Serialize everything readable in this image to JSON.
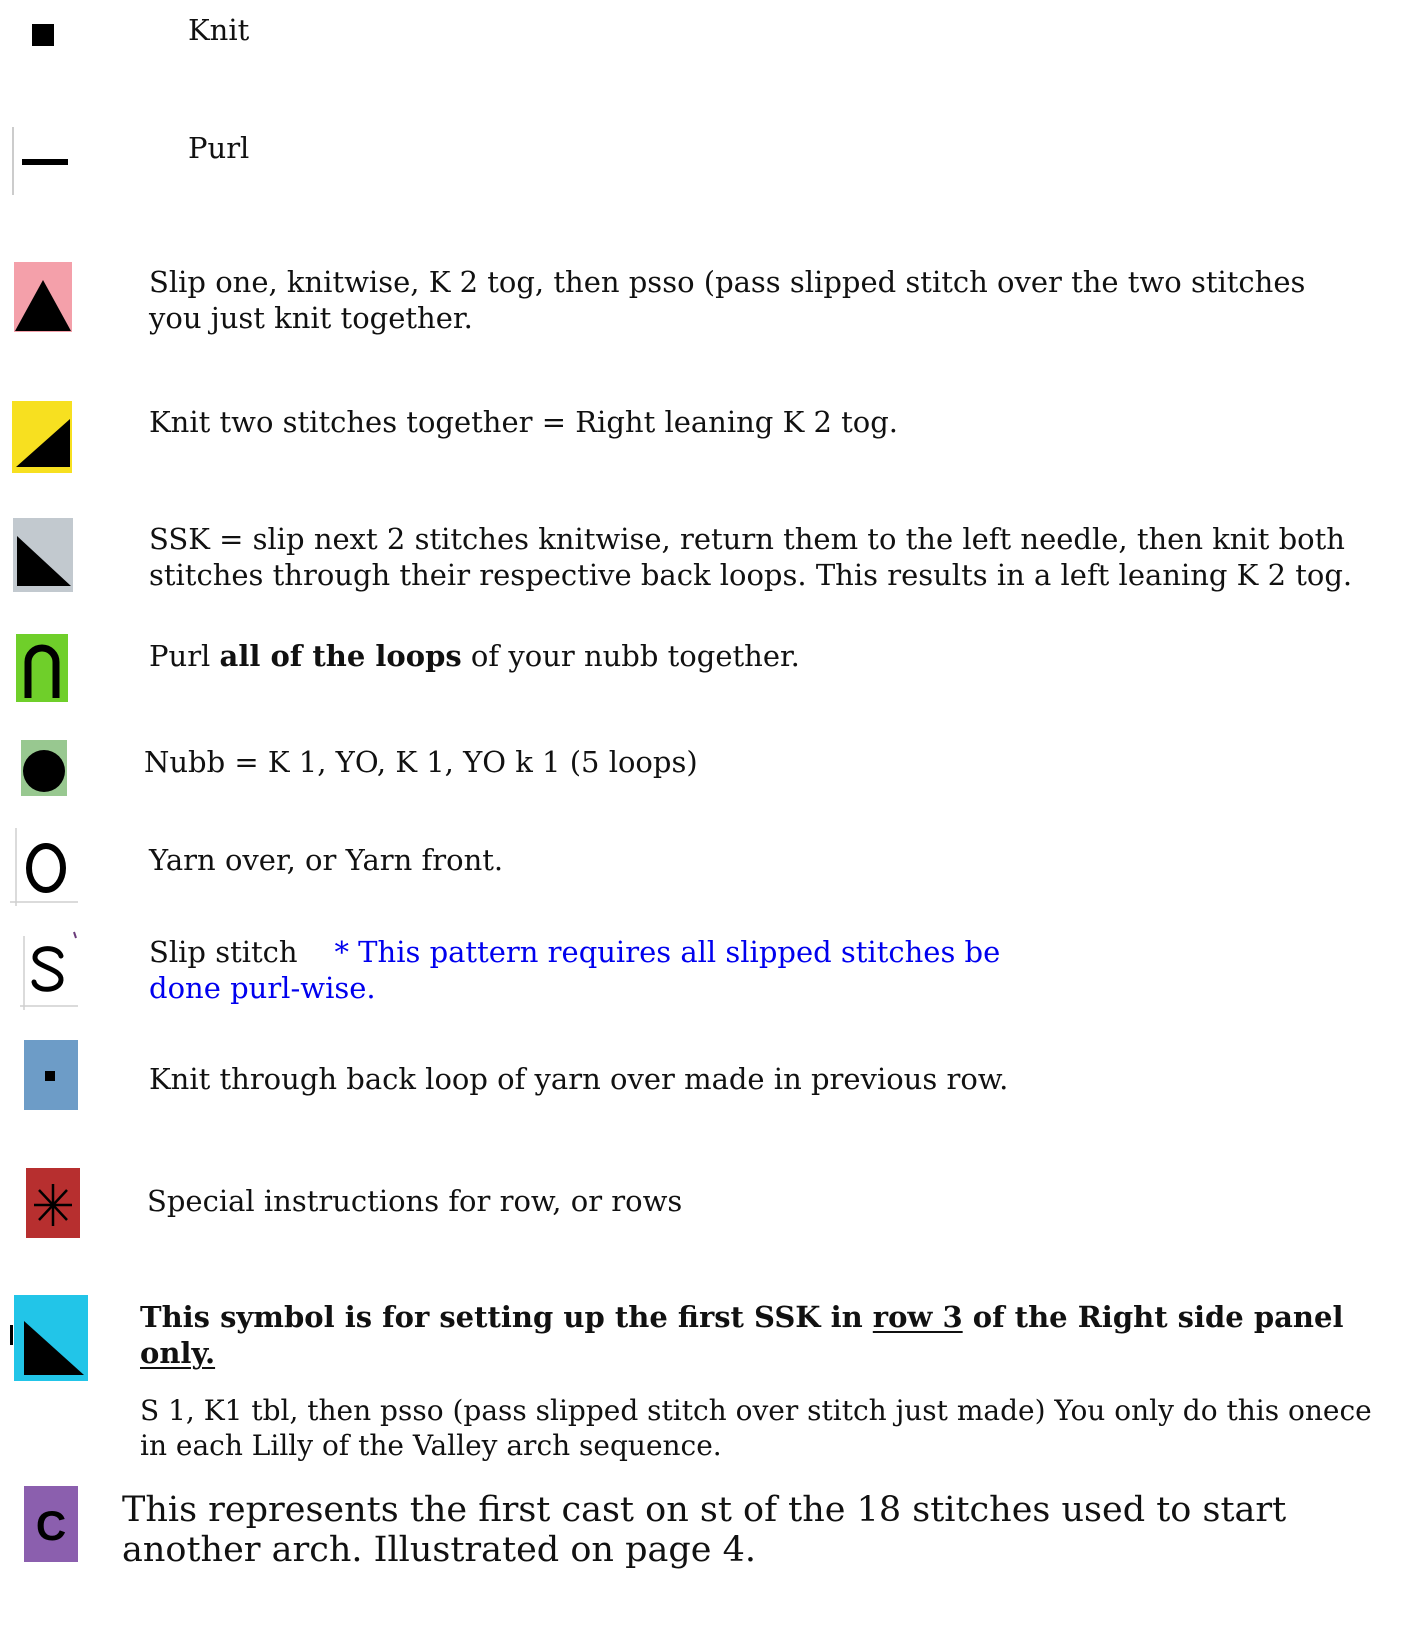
{
  "colors": {
    "knit_bg": "#ffffff",
    "sk2p_bg": "#f4a0aa",
    "k2tog_bg": "#f7e020",
    "ssk_bg": "#c2c9cf",
    "purl_loops_bg": "#6fcf2a",
    "nubb_bg": "#98c890",
    "ktbl_bg": "#6d9cc7",
    "special_bg": "#b72f2f",
    "setup_ssk_bg": "#22c5e8",
    "caston_bg": "#8b5fae",
    "note_blue": "#0000ee"
  },
  "legend": [
    {
      "icon": "knit-square-icon",
      "text": "Knit"
    },
    {
      "icon": "purl-dash-icon",
      "text": "Purl"
    },
    {
      "icon": "sk2p-triangle-icon",
      "text": "Slip one, knitwise,  K 2 tog,  then psso (pass slipped stitch over the  two stitches you just knit together."
    },
    {
      "icon": "k2tog-right-lean-icon",
      "text": "Knit two stitches together = Right leaning K 2 tog."
    },
    {
      "icon": "ssk-left-lean-icon",
      "text": "SSK =  slip next 2 stitches knitwise, return them to the left needle, then knit both stitches through their respective back loops.  This results in a left leaning K 2 tog."
    },
    {
      "icon": "purl-loops-arch-icon",
      "text_before": "Purl ",
      "text_bold": "all of the loops",
      "text_after": " of your nubb together."
    },
    {
      "icon": "nubb-dot-icon",
      "text": "Nubb = K 1, YO, K 1, YO k 1  (5 loops)"
    },
    {
      "icon": "yarn-over-o-icon",
      "text": "Yarn over, or Yarn front."
    },
    {
      "icon": "slip-stitch-s-icon",
      "text": "Slip stitch",
      "note": "* This pattern requires all slipped stitches be done purl-wise."
    },
    {
      "icon": "ktbl-small-square-icon",
      "text": "Knit through back loop of yarn over made in previous row."
    },
    {
      "icon": "special-asterisk-icon",
      "text": "Special instructions for row, or rows"
    },
    {
      "icon": "setup-ssk-icon",
      "heading_1": "This symbol is for setting up the first SSK in ",
      "heading_underline_1": "row 3",
      "heading_2": " of the Right side panel ",
      "heading_underline_2": "only. ",
      "text": "S 1, K1 tbl, then psso (pass slipped stitch over stitch just made)  You only do this onece in each  Lilly of the Valley arch sequence."
    },
    {
      "icon": "cast-on-c-icon",
      "text": "This represents the first cast on st of the 18 stitches used to start another arch.  Illustrated on page 4."
    }
  ]
}
